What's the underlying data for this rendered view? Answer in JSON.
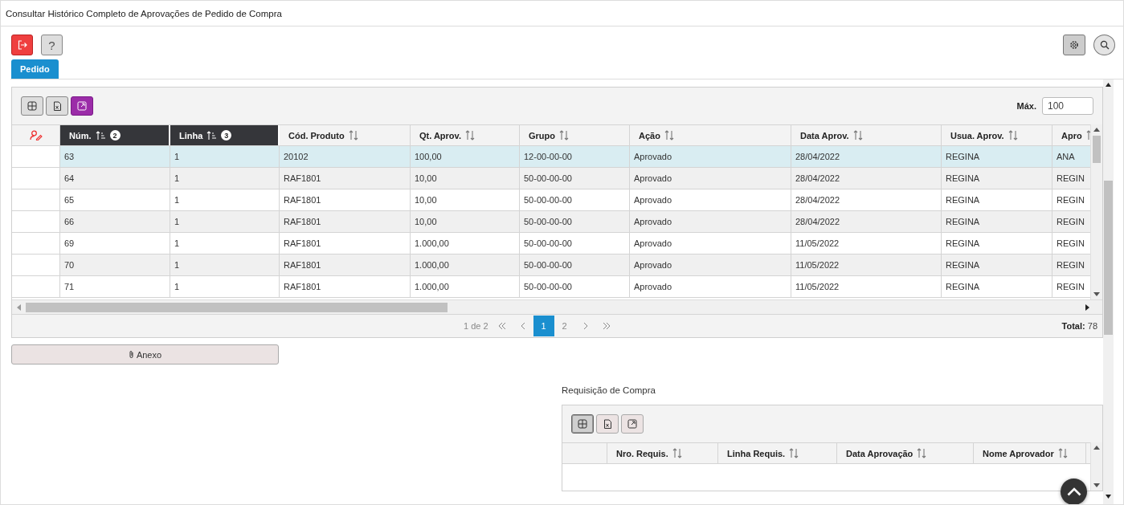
{
  "window": {
    "title": "Consultar Histórico Completo de Aprovações de Pedido de Compra"
  },
  "toolbar": {
    "help_label": "?"
  },
  "tabs": [
    {
      "label": "Pedido",
      "selected": true
    }
  ],
  "main_grid": {
    "lead_icon": true,
    "tools": [
      {
        "kind": "columns",
        "active": false
      },
      {
        "kind": "excel",
        "active": false
      },
      {
        "kind": "expand",
        "active": true
      }
    ],
    "max_label": "Máx.",
    "max_value": "100",
    "columns": [
      {
        "label": "Núm.",
        "sorted": true,
        "sort_order": "2"
      },
      {
        "label": "Linha",
        "sorted": true,
        "sort_order": "3"
      },
      {
        "label": "Cód. Produto",
        "sorted": false
      },
      {
        "label": "Qt. Aprov.",
        "sorted": false
      },
      {
        "label": "Grupo",
        "sorted": false
      },
      {
        "label": "Ação",
        "sorted": false
      },
      {
        "label": "Data Aprov.",
        "sorted": false
      },
      {
        "label": "Usua. Aprov.",
        "sorted": false
      },
      {
        "label": "Apro",
        "sorted": false
      }
    ],
    "rows": [
      {
        "selected": true,
        "cells": [
          "63",
          "1",
          "20102",
          "100,00",
          "12-00-00-00",
          "Aprovado",
          "28/04/2022",
          "REGINA",
          "ANA"
        ]
      },
      {
        "selected": false,
        "cells": [
          "64",
          "1",
          "RAF1801",
          "10,00",
          "50-00-00-00",
          "Aprovado",
          "28/04/2022",
          "REGINA",
          "REGIN"
        ]
      },
      {
        "selected": false,
        "cells": [
          "65",
          "1",
          "RAF1801",
          "10,00",
          "50-00-00-00",
          "Aprovado",
          "28/04/2022",
          "REGINA",
          "REGIN"
        ]
      },
      {
        "selected": false,
        "cells": [
          "66",
          "1",
          "RAF1801",
          "10,00",
          "50-00-00-00",
          "Aprovado",
          "28/04/2022",
          "REGINA",
          "REGIN"
        ]
      },
      {
        "selected": false,
        "cells": [
          "69",
          "1",
          "RAF1801",
          "1.000,00",
          "50-00-00-00",
          "Aprovado",
          "11/05/2022",
          "REGINA",
          "REGIN"
        ]
      },
      {
        "selected": false,
        "cells": [
          "70",
          "1",
          "RAF1801",
          "1.000,00",
          "50-00-00-00",
          "Aprovado",
          "11/05/2022",
          "REGINA",
          "REGIN"
        ]
      },
      {
        "selected": false,
        "cells": [
          "71",
          "1",
          "RAF1801",
          "1.000,00",
          "50-00-00-00",
          "Aprovado",
          "11/05/2022",
          "REGINA",
          "REGIN"
        ]
      }
    ],
    "pager": {
      "info": "1 de 2",
      "pages": [
        {
          "label": "1",
          "selected": true
        },
        {
          "label": "2",
          "selected": false
        }
      ],
      "total_label": "Total:",
      "total_value": "78"
    }
  },
  "attachment_button": "Anexo",
  "requisition": {
    "title": "Requisição de Compra",
    "lead_icon": false,
    "tools": [
      {
        "kind": "columns",
        "active": true
      },
      {
        "kind": "excel",
        "active": false
      },
      {
        "kind": "expand",
        "active": false
      }
    ],
    "columns": [
      {
        "label": "Nro. Requis.",
        "sorted": false
      },
      {
        "label": "Linha Requis.",
        "sorted": false
      },
      {
        "label": "Data Aprovação",
        "sorted": false
      },
      {
        "label": "Nome Aprovador",
        "sorted": false
      }
    ]
  }
}
